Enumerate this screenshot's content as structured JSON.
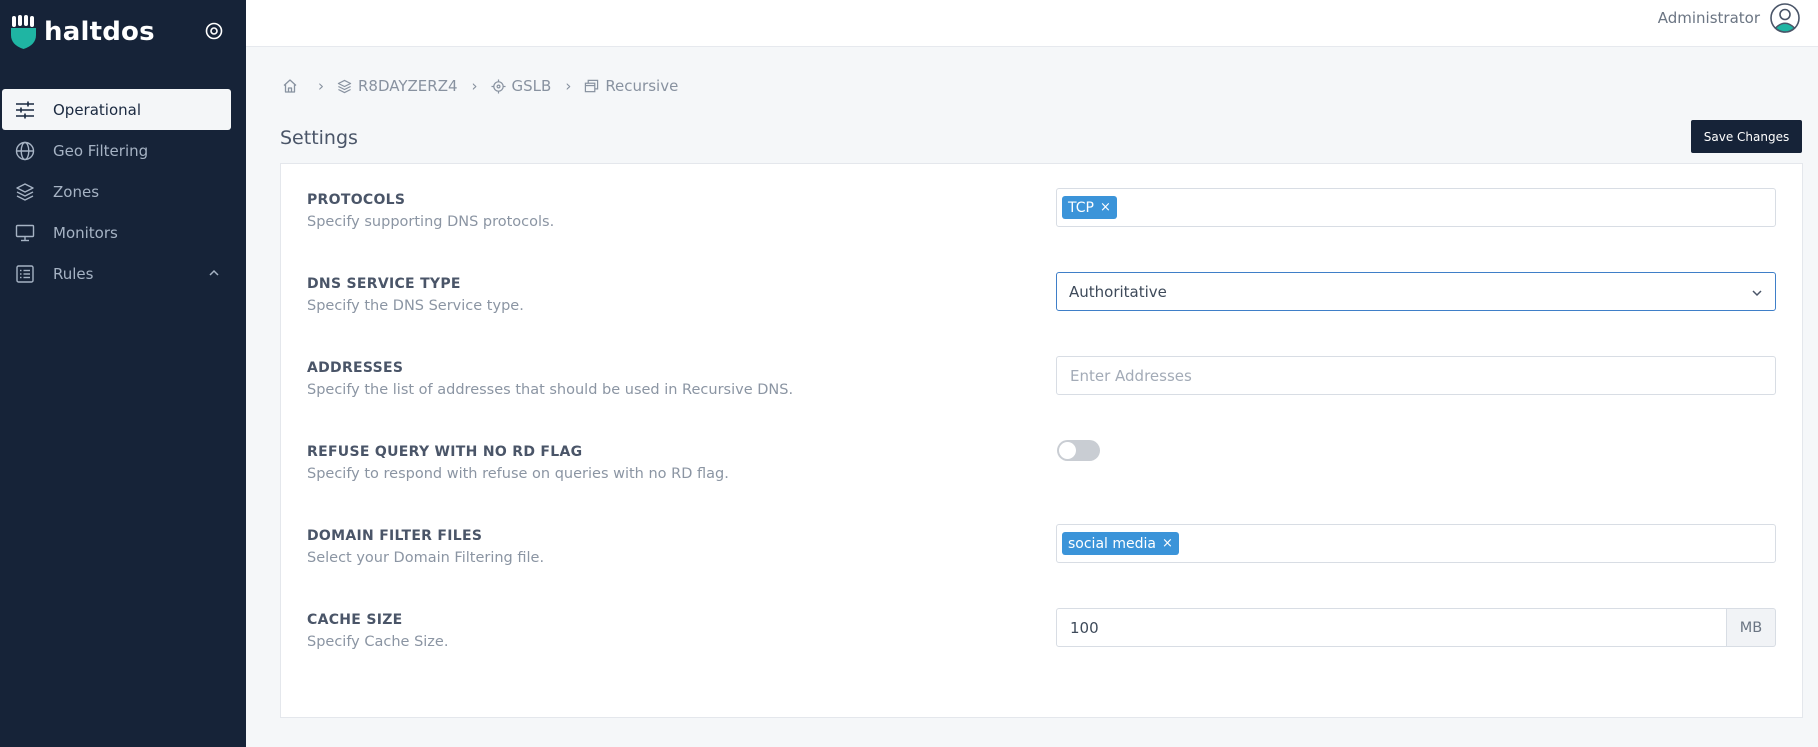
{
  "brand": {
    "name": "haltdos"
  },
  "sidebar": {
    "items": [
      {
        "label": "Operational",
        "icon": "sliders-icon"
      },
      {
        "label": "Geo Filtering",
        "icon": "globe-icon"
      },
      {
        "label": "Zones",
        "icon": "layers-icon"
      },
      {
        "label": "Monitors",
        "icon": "monitor-icon"
      },
      {
        "label": "Rules",
        "icon": "list-icon"
      }
    ]
  },
  "topbar": {
    "user": "Administrator"
  },
  "breadcrumb": {
    "items": [
      {
        "label": "R8DAYZERZ4"
      },
      {
        "label": "GSLB"
      },
      {
        "label": "Recursive"
      }
    ],
    "separator": "›"
  },
  "page": {
    "title": "Settings",
    "save_label": "Save Changes"
  },
  "settings": {
    "protocols": {
      "label": "PROTOCOLS",
      "desc": "Specify supporting DNS protocols.",
      "tags": [
        "TCP"
      ]
    },
    "service_type": {
      "label": "DNS SERVICE TYPE",
      "desc": "Specify the DNS Service type.",
      "value": "Authoritative"
    },
    "addresses": {
      "label": "ADDRESSES",
      "desc": "Specify the list of addresses that should be used in Recursive DNS.",
      "placeholder": "Enter Addresses"
    },
    "refuse_query": {
      "label": "REFUSE QUERY WITH NO RD FLAG",
      "desc": "Specify to respond with refuse on queries with no RD flag.",
      "enabled": false
    },
    "domain_filter": {
      "label": "DOMAIN FILTER FILES",
      "desc": "Select your Domain Filtering file.",
      "tags": [
        "social media"
      ]
    },
    "cache_size": {
      "label": "CACHE SIZE",
      "desc": "Specify Cache Size.",
      "value": "100",
      "unit": "MB"
    }
  },
  "colors": {
    "sidebar_bg": "#162338",
    "accent": "#3b94d9",
    "brand_teal": "#1fb5a3"
  }
}
